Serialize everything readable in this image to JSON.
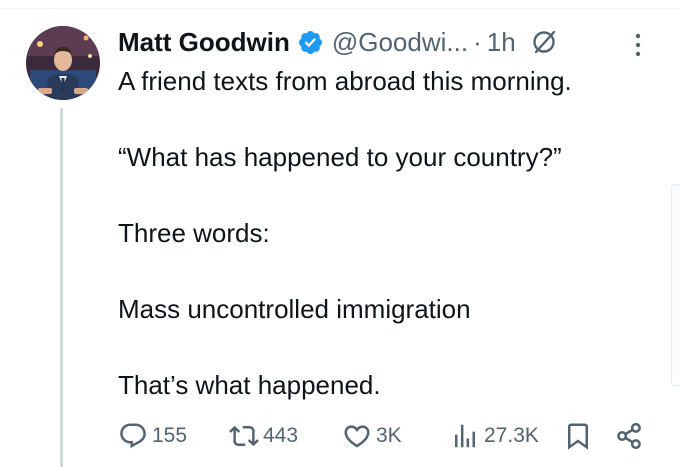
{
  "tweet": {
    "author_name": "Matt Goodwin",
    "handle": "@Goodwi...",
    "separator": "·",
    "time_ago": "1h",
    "text_lines": [
      "A friend texts from abroad this morning.",
      "“What has happened to your country?”",
      "Three words:",
      "Mass uncontrolled immigration",
      "That’s what happened."
    ]
  },
  "actions": {
    "replies": "155",
    "reposts": "443",
    "likes": "3K",
    "views": "27.3K"
  },
  "colors": {
    "text": "#0f1419",
    "secondary": "#536471",
    "verified": "#1d9bf0",
    "thread_line": "#cfd9de"
  },
  "icons": {
    "verified": "verified-badge-icon",
    "grok": "grok-icon",
    "more": "more-vertical-icon",
    "reply": "reply-icon",
    "repost": "repost-icon",
    "like": "like-icon",
    "views": "views-icon",
    "bookmark": "bookmark-icon",
    "share": "share-icon"
  }
}
